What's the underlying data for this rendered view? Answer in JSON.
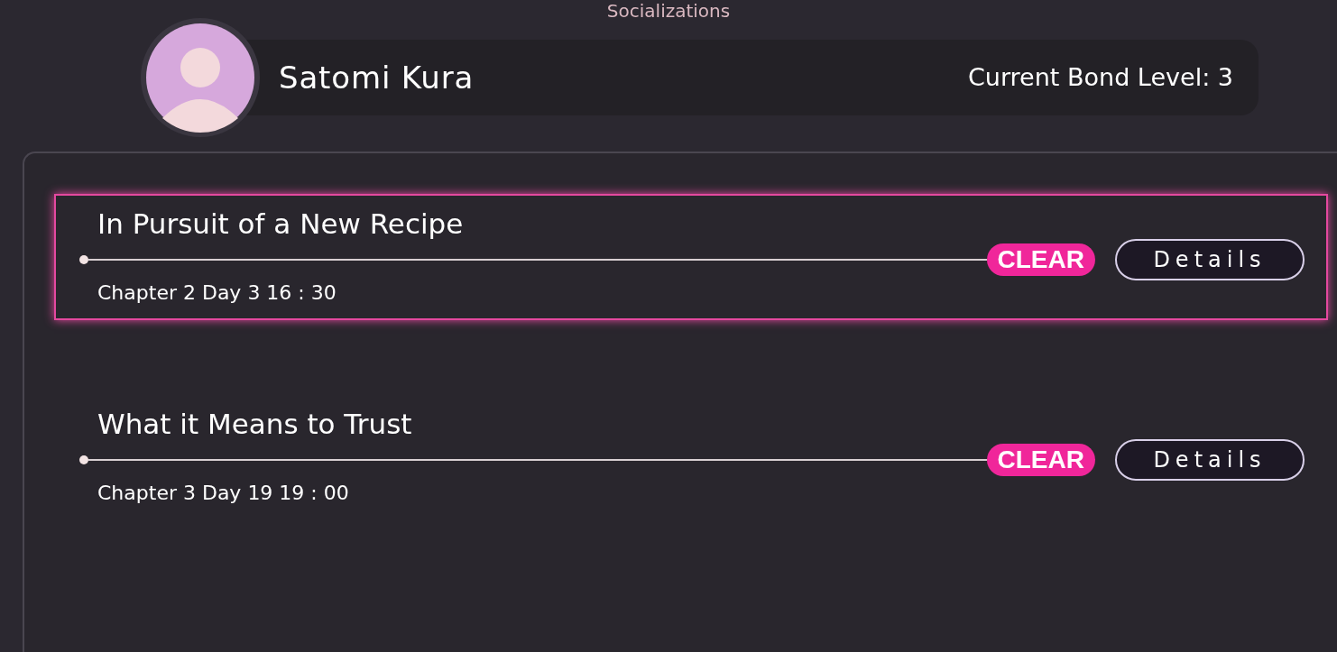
{
  "screen_title": "Socializations",
  "character": {
    "name": "Satomi Kura",
    "bond_level": "Current Bond Level: 3"
  },
  "events": [
    {
      "title": "In Pursuit of a New Recipe",
      "time": "Chapter 2 Day 3 16 : 30",
      "status": "CLEAR",
      "button": "Details",
      "selected": true
    },
    {
      "title": "What it Means to Trust",
      "time": "Chapter 3 Day 19 19 : 00",
      "status": "CLEAR",
      "button": "Details",
      "selected": false
    }
  ]
}
